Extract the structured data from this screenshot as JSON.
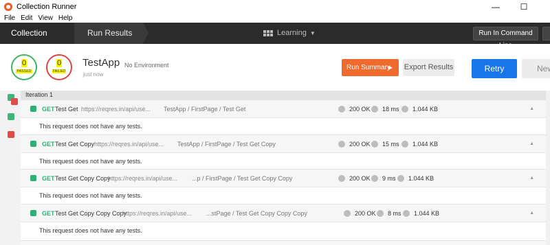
{
  "window": {
    "title": "Collection Runner",
    "minimize": "—",
    "maximize": "☐"
  },
  "menu": [
    "File",
    "Edit",
    "View",
    "Help"
  ],
  "header": {
    "tab_collection_runner": "Collection Runner",
    "tab_run_results": "Run Results",
    "workspace": "Learning",
    "run_cmd_button": "Run In Command Line"
  },
  "summary": {
    "passed_count": "0",
    "passed_label": "PASSED",
    "failed_count": "0",
    "failed_label": "FAILED",
    "collection": "TestApp",
    "environment": "No Environment",
    "time": "just now",
    "run_summary_button": "Run Summary",
    "export_button": "Export Results",
    "retry_button": "Retry",
    "new_button": "New"
  },
  "iteration": {
    "label": "Iteration 1"
  },
  "requests": [
    {
      "method": "GET",
      "name": "Test Get",
      "url": "https://reqres.in/api/use...",
      "path": "TestApp / FirstPage / Test Get",
      "status": "200 OK",
      "time": "18 ms",
      "size": "1.044 KB",
      "tests_msg": "This request does not have any tests."
    },
    {
      "method": "GET",
      "name": "Test Get Copy",
      "url": "https://reqres.in/api/use...",
      "path": "TestApp / FirstPage / Test Get Copy",
      "status": "200 OK",
      "time": "15 ms",
      "size": "1.044 KB",
      "tests_msg": "This request does not have any tests."
    },
    {
      "method": "GET",
      "name": "Test Get Copy Copy",
      "url": "https://reqres.in/api/use...",
      "path": "...p / FirstPage / Test Get Copy Copy",
      "status": "200 OK",
      "time": "9 ms",
      "size": "1.044 KB",
      "tests_msg": "This request does not have any tests."
    },
    {
      "method": "GET",
      "name": "Test Get Copy Copy Copy",
      "url": "https://reqres.in/api/use...",
      "path": "...stPage / Test Get Copy Copy Copy",
      "status": "200 OK",
      "time": "8 ms",
      "size": "1.044 KB",
      "tests_msg": "This request does not have any tests."
    }
  ],
  "colors": {
    "accent_orange": "#ef6b2d",
    "accent_blue": "#1976e8",
    "pass": "#3bb55f",
    "fail": "#d94545",
    "header_bg": "#2b2b2b"
  }
}
